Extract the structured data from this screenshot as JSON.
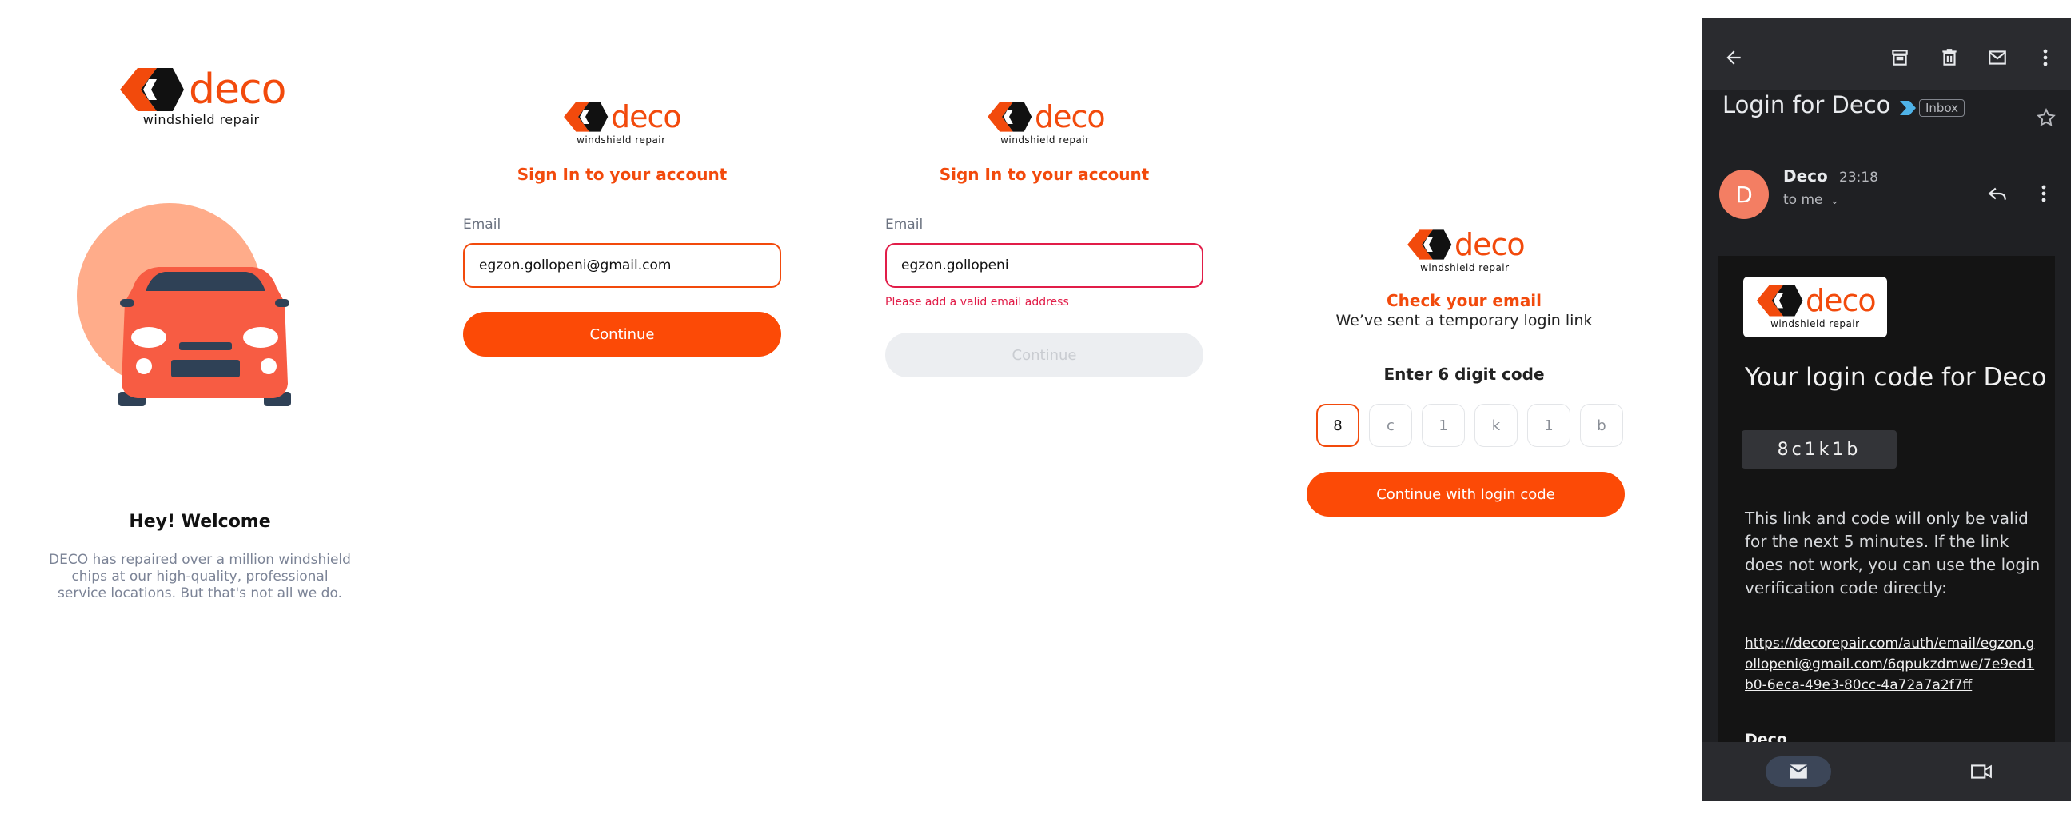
{
  "colors": {
    "brand": "#f24a0c",
    "button": "#fc4a06",
    "error": "#e11d48",
    "avatar": "#f37e63"
  },
  "logo": {
    "word": "deco",
    "sub": "windshield repair"
  },
  "welcome": {
    "title": "Hey! Welcome",
    "text": "DECO has repaired over a million windshield chips at our high-quality, professional service locations. But that's not all we do.",
    "illustration": "car-illustration"
  },
  "signin_valid": {
    "title": "Sign In to your account",
    "email_label": "Email",
    "email_value": "egzon.gollopeni@gmail.com",
    "button": "Continue"
  },
  "signin_invalid": {
    "title": "Sign In to your account",
    "email_label": "Email",
    "email_value": "egzon.gollopeni",
    "error": "Please add a valid email address",
    "button": "Continue"
  },
  "check_email": {
    "title": "Check your email",
    "subtitle": "We’ve sent a temporary login link",
    "code_label": "Enter 6 digit code",
    "code": [
      "8",
      "c",
      "1",
      "k",
      "1",
      "b"
    ],
    "button": "Continue with login code"
  },
  "email": {
    "subject": "Login for Deco",
    "label": "Inbox",
    "avatar_letter": "D",
    "sender": "Deco",
    "time": "23:18",
    "to": "to me",
    "heading": "Your login code for Deco",
    "code": "8c1k1b",
    "body": "This link and code will only be valid for the next 5 minutes. If the link does not work, you can use the login verification code directly:",
    "link": "https://decorepair.com/auth/email/egzon.gollopeni@gmail.com/6qpukzdmwe/7e9ed1b0-6eca-49e3-80cc-4a72a7a2f7ff",
    "signature": "Deco",
    "icons": [
      "back-arrow-icon",
      "archive-icon",
      "trash-icon",
      "mail-icon",
      "more-vert-icon",
      "star-icon",
      "reply-icon",
      "video-icon"
    ]
  }
}
